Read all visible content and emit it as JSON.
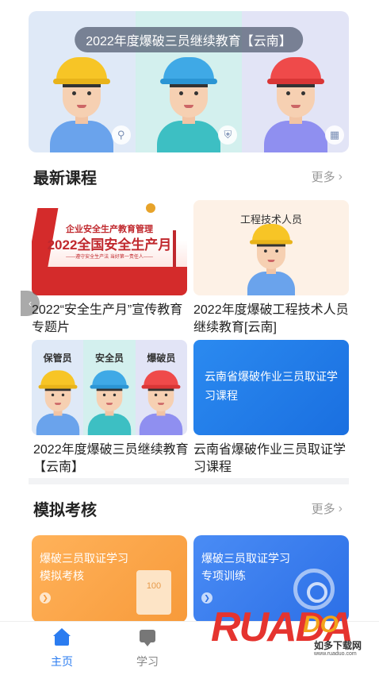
{
  "banner": {
    "title": "2022年度爆破三员继续教育【云南】",
    "helmet_colors": [
      "#f7c526",
      "#3fa9e6",
      "#ef4a4a"
    ],
    "shirt_colors": [
      "#6aa3ec",
      "#3dbfc3",
      "#8f8ff0"
    ],
    "badges": [
      "lock-icon",
      "shield-icon",
      "building-icon"
    ]
  },
  "latest": {
    "title": "最新课程",
    "more": "更多",
    "courses": [
      {
        "title": "2022“安全生产月”宣传教育专题片",
        "image": {
          "line1": "企业安全生产教育管理",
          "line2": "2022全国安全生产月",
          "line3": "——遵守安全生产法 当好第一责任人——"
        }
      },
      {
        "title": "2022年度爆破工程技术人员继续教育[云南]",
        "image": {
          "label": "工程技术人员"
        }
      },
      {
        "title": "2022年度爆破三员继续教育【云南】",
        "image": {
          "labels": [
            "保管员",
            "安全员",
            "爆破员"
          ]
        }
      },
      {
        "title": "云南省爆破作业三员取证学习课程",
        "image": {
          "text": "云南省爆破作业三员取证学习课程"
        }
      }
    ]
  },
  "exam": {
    "title": "模拟考核",
    "more": "更多",
    "cards": [
      {
        "line1": "爆破三员取证学习",
        "line2": "模拟考核",
        "paper": "100"
      },
      {
        "line1": "爆破三员取证学习",
        "line2": "专项训练"
      }
    ]
  },
  "tabs": [
    {
      "label": "主页",
      "active": true
    },
    {
      "label": "学习",
      "active": false
    }
  ],
  "watermark": {
    "logo": "RUADA",
    "logo2": "DO",
    "cn": "如多下载网",
    "url": "www.ruaduo.com"
  },
  "colors": {
    "accent": "#2b7cf0",
    "orange": "#f79a3a",
    "red": "#d42b2b"
  }
}
